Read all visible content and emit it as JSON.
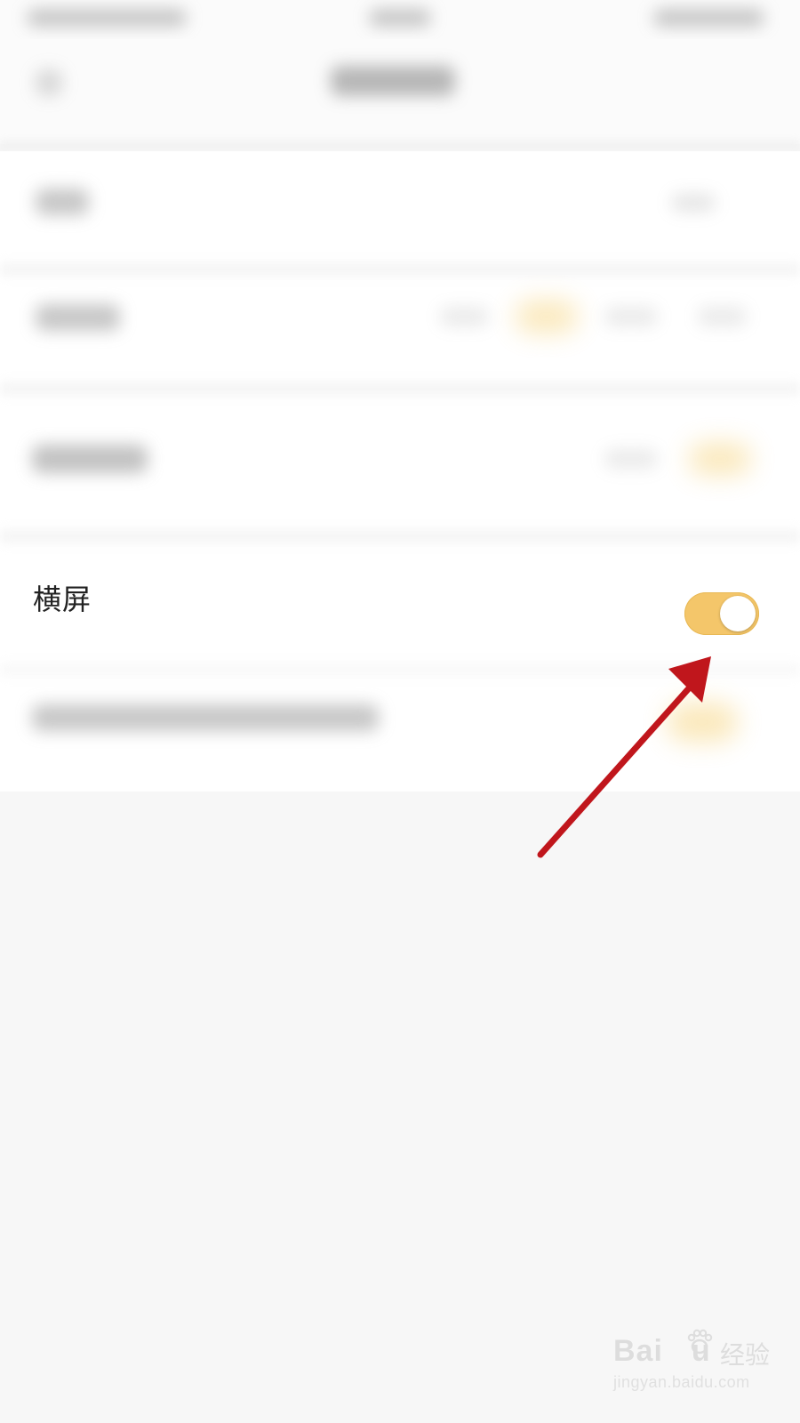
{
  "settings": {
    "landscape_label": "横屏",
    "landscape_toggle_on": true
  },
  "colors": {
    "toggle_on": "#f4c66a",
    "annotation_arrow": "#c0161c"
  },
  "watermark": {
    "brand": "Bai",
    "brand_suffix": "u",
    "cn": "经验",
    "url": "jingyan.baidu.com"
  }
}
